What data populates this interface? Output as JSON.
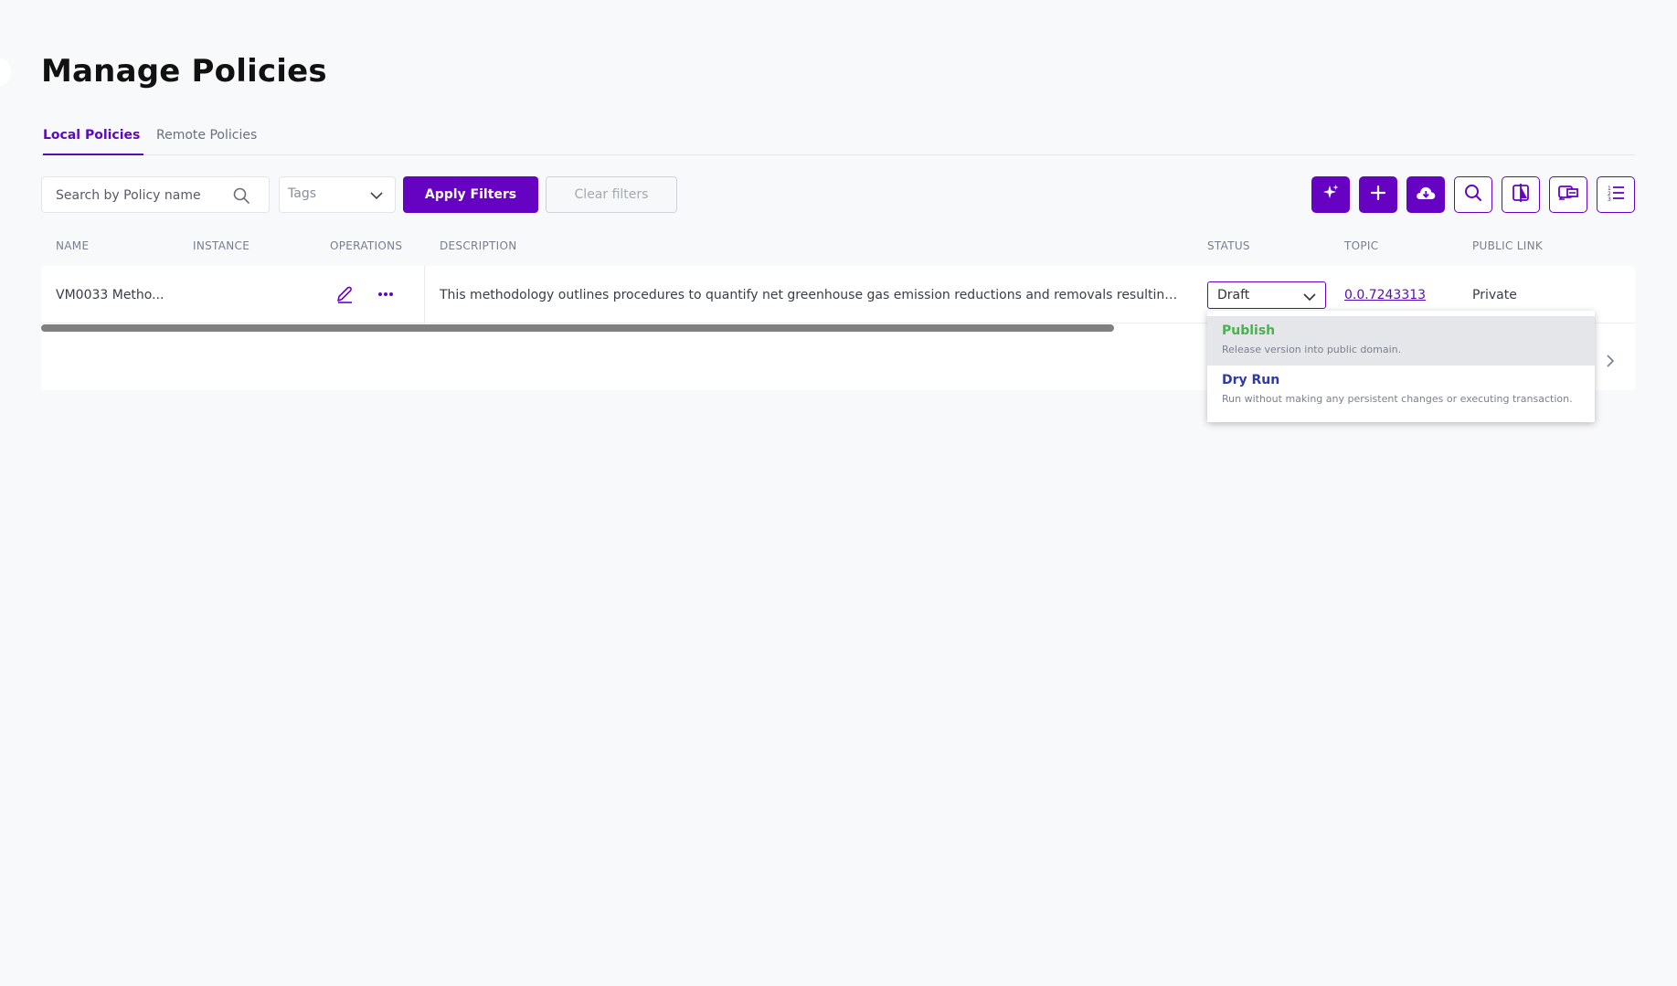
{
  "page": {
    "title": "Manage Policies"
  },
  "tabs": [
    {
      "label": "Local Policies",
      "active": true
    },
    {
      "label": "Remote Policies",
      "active": false
    }
  ],
  "filters": {
    "search_placeholder": "Search by Policy name",
    "tags_placeholder": "Tags",
    "apply_label": "Apply Filters",
    "clear_label": "Clear filters"
  },
  "toolbar": {
    "icons": [
      "sparkle-icon",
      "plus-icon",
      "cloud-download-icon",
      "search-icon",
      "compare-icon",
      "import-export-icon",
      "ordered-list-icon"
    ]
  },
  "table": {
    "columns": [
      "NAME",
      "INSTANCE",
      "OPERATIONS",
      "DESCRIPTION",
      "STATUS",
      "TOPIC",
      "PUBLIC LINK"
    ],
    "rows": [
      {
        "name": "VM0033 Metho...",
        "instance": "",
        "description": "This methodology outlines procedures to quantify net greenhouse gas emission reductions and removals resulting from tidal wetland and seagrass restoration",
        "status": "Draft",
        "topic": "0.0.7243313",
        "public_link": "Private"
      }
    ]
  },
  "status_dropdown": {
    "options": [
      {
        "title": "Publish",
        "description": "Release version into public domain."
      },
      {
        "title": "Dry Run",
        "description": "Run without making any persistent changes or executing transaction."
      }
    ]
  },
  "colors": {
    "accent": "#6603c2",
    "publish": "#4caf50",
    "dry_run": "#2d3aa8",
    "background": "#f8f9fb"
  }
}
